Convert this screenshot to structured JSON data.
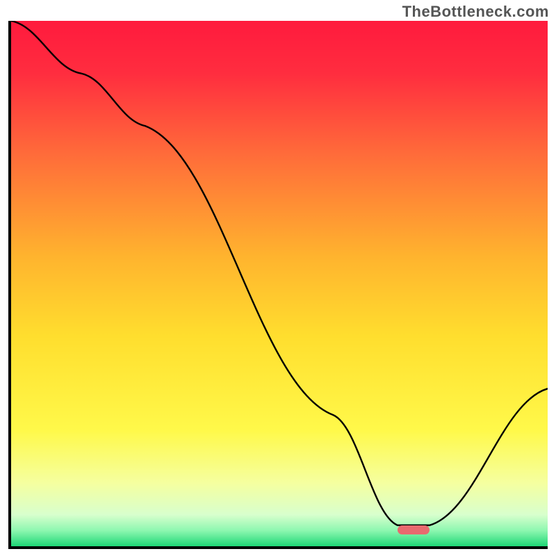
{
  "watermark": "TheBottleneck.com",
  "chart_data": {
    "type": "line",
    "title": "",
    "xlabel": "",
    "ylabel": "",
    "x_range": [
      0,
      100
    ],
    "y_range": [
      0,
      100
    ],
    "series": [
      {
        "name": "bottleneck-curve",
        "x": [
          0,
          13,
          25,
          60,
          72,
          78,
          100
        ],
        "y": [
          100,
          90,
          80,
          25,
          4,
          4,
          30
        ]
      }
    ],
    "sweet_spot": {
      "x_start": 72,
      "x_end": 78,
      "y": 3
    },
    "background_gradient": {
      "stops": [
        {
          "pos": 0.0,
          "color": "#ff1a3d"
        },
        {
          "pos": 0.1,
          "color": "#ff2d3f"
        },
        {
          "pos": 0.25,
          "color": "#ff6a3a"
        },
        {
          "pos": 0.45,
          "color": "#ffb42e"
        },
        {
          "pos": 0.6,
          "color": "#ffde2e"
        },
        {
          "pos": 0.78,
          "color": "#fff94a"
        },
        {
          "pos": 0.88,
          "color": "#f5ffa0"
        },
        {
          "pos": 0.94,
          "color": "#d8ffcd"
        },
        {
          "pos": 0.97,
          "color": "#8df7b0"
        },
        {
          "pos": 1.0,
          "color": "#1ed776"
        }
      ]
    }
  }
}
